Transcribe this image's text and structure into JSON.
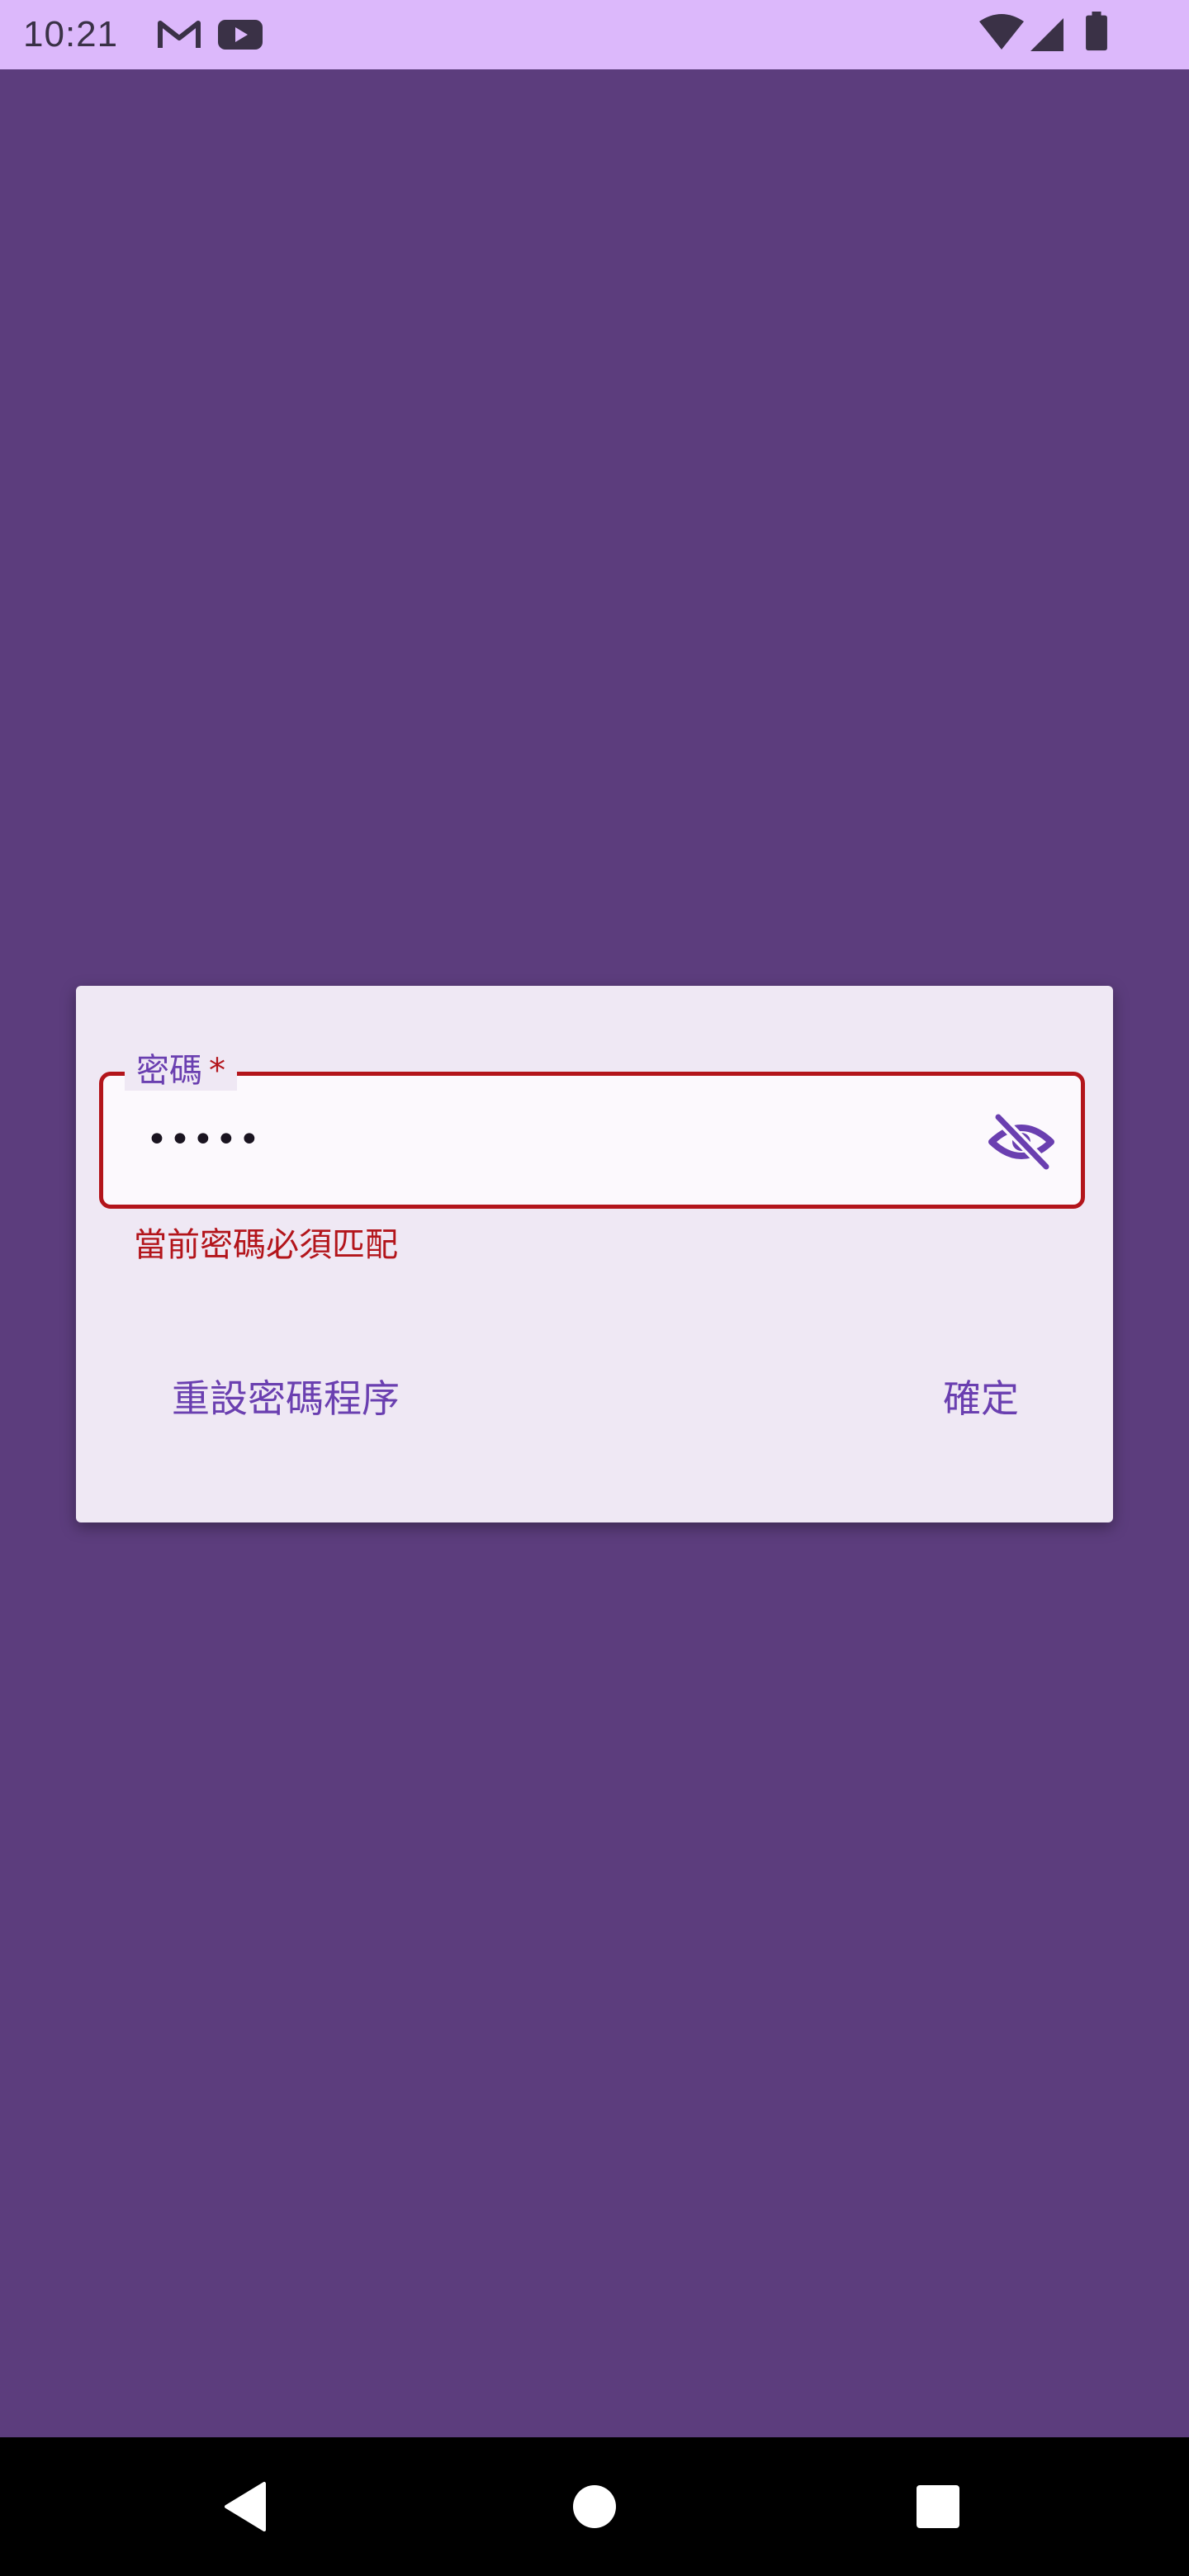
{
  "status_bar": {
    "time": "10:21",
    "left_icons": [
      "gmail-icon",
      "youtube-icon"
    ],
    "right_icons": [
      "wifi-icon",
      "cell-signal-icon",
      "battery-icon"
    ]
  },
  "dialog": {
    "password_field": {
      "label": "密碼",
      "required_marker": "*",
      "value": "•••••",
      "toggle_icon": "visibility-off-icon"
    },
    "error_message": "當前密碼必須匹配",
    "reset_button_label": "重設密碼程序",
    "confirm_button_label": "確定"
  },
  "nav_bar": {
    "buttons": [
      "back-icon",
      "home-icon",
      "recents-icon"
    ]
  },
  "colors": {
    "background": "#5c3d7d",
    "status_bar": "#dcb8fb",
    "dialog_surface": "#efe8f4",
    "accent": "#6a3fb0",
    "error": "#b3151b"
  }
}
